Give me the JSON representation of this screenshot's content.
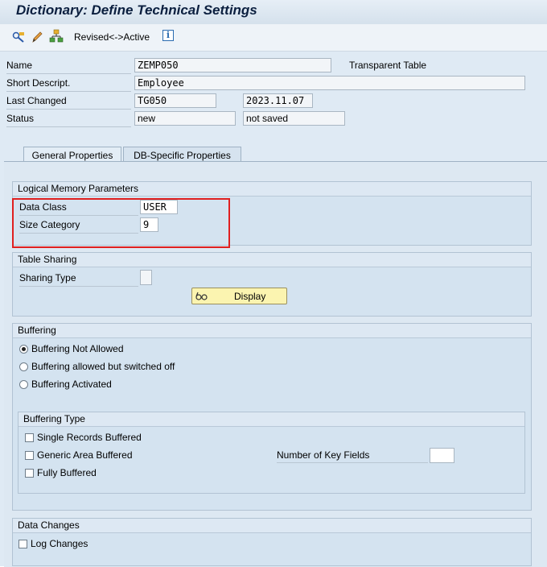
{
  "window": {
    "title": "Dictionary: Define Technical Settings"
  },
  "toolbar": {
    "revised_active_label": "Revised<->Active"
  },
  "header": {
    "name_label": "Name",
    "name_value": "ZEMP050",
    "table_type": "Transparent Table",
    "short_desc_label": "Short Descript.",
    "short_desc_value": "Employee",
    "last_changed_label": "Last Changed",
    "last_changed_user": "TG050",
    "last_changed_date": "2023.11.07",
    "status_label": "Status",
    "status_value": "new",
    "status_save": "not saved"
  },
  "tabs": [
    {
      "label": "General Properties",
      "active": true
    },
    {
      "label": "DB-Specific Properties",
      "active": false
    }
  ],
  "logical_memory": {
    "title": "Logical Memory Parameters",
    "data_class_label": "Data Class",
    "data_class_value": "USER",
    "size_category_label": "Size Category",
    "size_category_value": "9"
  },
  "table_sharing": {
    "title": "Table Sharing",
    "sharing_type_label": "Sharing Type",
    "sharing_type_value": "",
    "display_button": "Display"
  },
  "buffering": {
    "title": "Buffering",
    "options": [
      {
        "label": "Buffering Not Allowed",
        "selected": true
      },
      {
        "label": "Buffering allowed but switched off",
        "selected": false
      },
      {
        "label": "Buffering Activated",
        "selected": false
      }
    ]
  },
  "buffering_type": {
    "title": "Buffering Type",
    "options": [
      {
        "label": "Single Records Buffered",
        "checked": false
      },
      {
        "label": "Generic Area Buffered",
        "checked": false
      },
      {
        "label": "Fully Buffered",
        "checked": false
      }
    ],
    "key_fields_label": "Number of Key Fields",
    "key_fields_value": ""
  },
  "data_changes": {
    "title": "Data Changes",
    "log_changes_label": "Log Changes",
    "log_changes_checked": false
  },
  "colors": {
    "highlight_box": "#e02020",
    "button_yellow": "#fbf4b0"
  }
}
